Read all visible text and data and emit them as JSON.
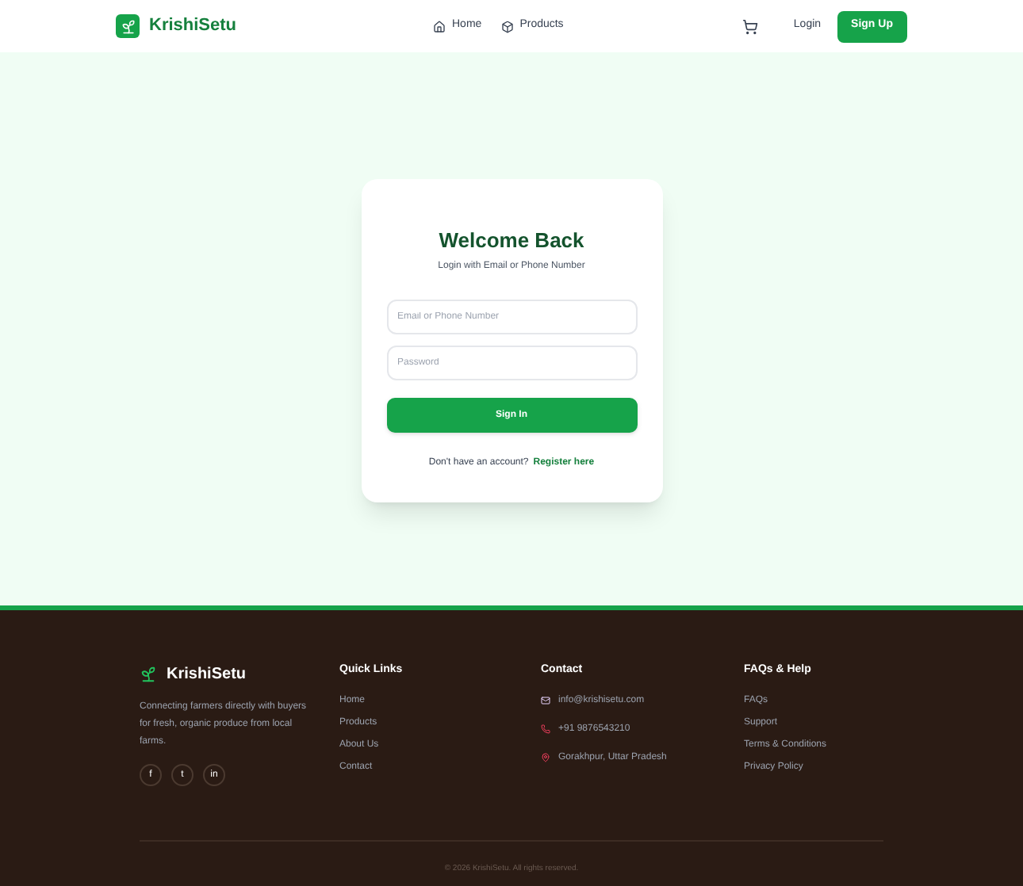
{
  "header": {
    "brand": "KrishiSetu",
    "nav": [
      {
        "label": "Home",
        "kind": "home"
      },
      {
        "label": "Products",
        "kind": "products"
      }
    ],
    "login": "Login",
    "signup": "Sign Up"
  },
  "login_card": {
    "title": "Welcome Back",
    "subtitle": "Login with Email or Phone Number",
    "fields": [
      {
        "placeholder": "Email or Phone Number"
      },
      {
        "placeholder": "Password"
      }
    ],
    "submit": "Sign In",
    "register_prompt": "Don't have an account?",
    "register_link": "Register here"
  },
  "footer": {
    "brand": "KrishiSetu",
    "tagline": "Connecting farmers directly with buyers for fresh, organic produce from local farms.",
    "social": [
      "f",
      "t",
      "in"
    ],
    "quick_links": {
      "title": "Quick Links",
      "items": [
        "Home",
        "Products",
        "About Us",
        "Contact"
      ]
    },
    "contact": {
      "title": "Contact",
      "items": [
        {
          "kind": "email",
          "text": "info@krishisetu.com"
        },
        {
          "kind": "phone",
          "text": "+91 9876543210"
        },
        {
          "kind": "location",
          "text": "Gorakhpur, Uttar Pradesh"
        }
      ]
    },
    "help": {
      "title": "FAQs & Help",
      "items": [
        "FAQs",
        "Support",
        "Terms & Conditions",
        "Privacy Policy"
      ]
    },
    "copyright": "© 2026 KrishiSetu. All rights reserved."
  }
}
